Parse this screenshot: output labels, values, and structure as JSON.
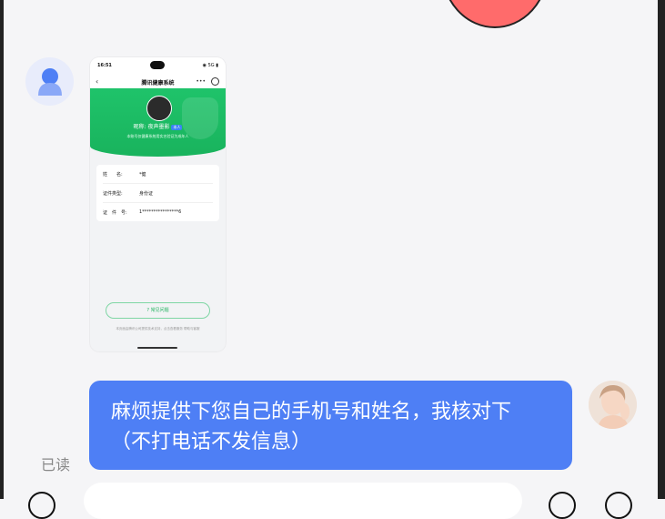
{
  "chat": {
    "message_text": "麻烦提供下您自己的手机号和姓名，我核对下（不打电话不发信息）",
    "read_status": "已读"
  },
  "screenshot": {
    "status_time": "16:51",
    "status_right": "◉ 5G ▮",
    "nav_back": "‹",
    "nav_title": "腾讯健康系统",
    "nav_more": "•••",
    "nickname": "昵称: 夜声墨影",
    "nickname_tag": "本人",
    "hint": "本账号仅健康系统用实名验证为成年人",
    "rows": [
      {
        "label": "姓　　名:",
        "value": "*健"
      },
      {
        "label": "证件类型:",
        "value": "身份证"
      },
      {
        "label": "证　件　号:",
        "value": "1****************6"
      }
    ],
    "faq_label": "? 常见问题",
    "footer": "本页面由腾讯公司提供技术支持，点击查看服务 帮助与客服"
  },
  "colors": {
    "bubble": "#4e7ff5",
    "hero_green": "#1fc36a",
    "background": "#f5f5f7"
  }
}
